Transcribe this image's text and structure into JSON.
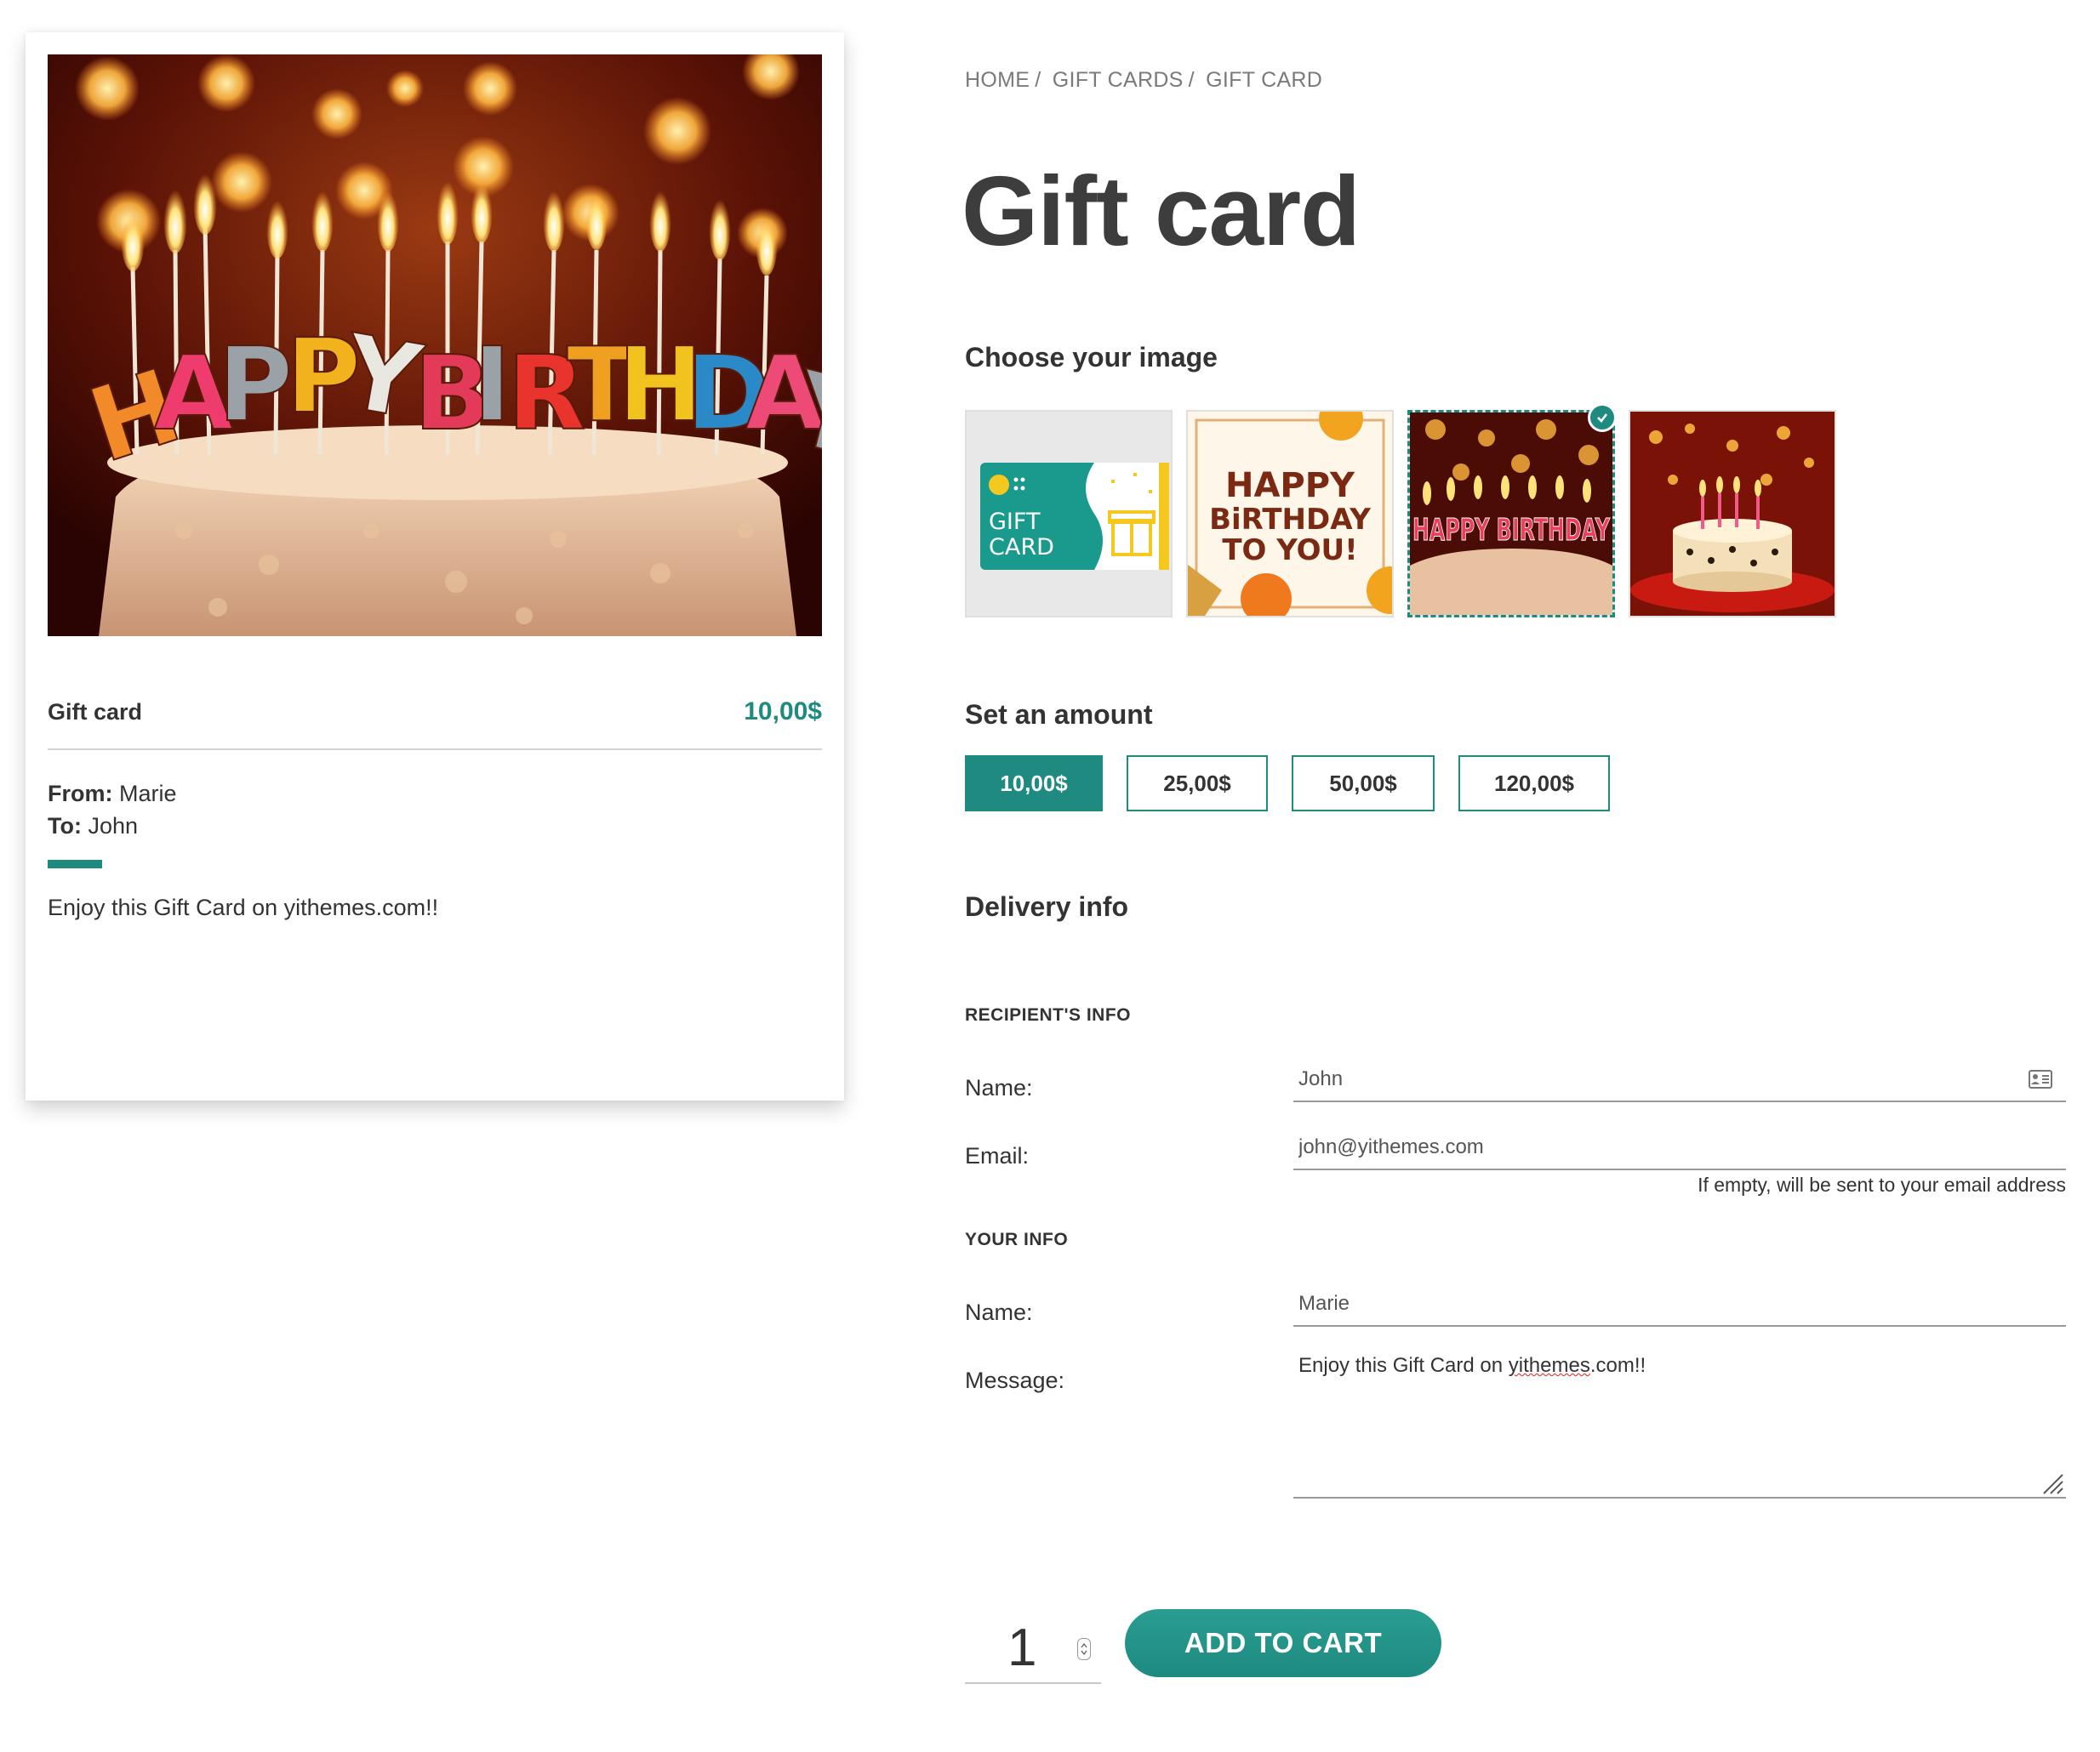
{
  "preview": {
    "title": "Gift card",
    "price": "10,00$",
    "from_label": "From:",
    "from_value": "Marie",
    "to_label": "To:",
    "to_value": "John",
    "message": "Enjoy this Gift Card on yithemes.com!!",
    "image_letters": "HAPPY BIRTHDAY"
  },
  "breadcrumb": [
    "HOME",
    "GIFT CARDS",
    "GIFT CARD"
  ],
  "breadcrumb_sep": "/",
  "page_title": "Gift card",
  "choose_image": {
    "heading": "Choose your image",
    "thumbs": [
      {
        "name": "gift-card-default",
        "line1": "GIFT",
        "line2": "CARD"
      },
      {
        "name": "happy-birthday-to-you",
        "line1": "HAPPY",
        "line2": "BiRTHDAY",
        "line3": "TO YOU!"
      },
      {
        "name": "happy-birthday-candles",
        "line1": "HAPPY BIRTHDAY",
        "selected": true
      },
      {
        "name": "birthday-cake"
      }
    ]
  },
  "amount": {
    "heading": "Set an amount",
    "options": [
      "10,00$",
      "25,00$",
      "50,00$",
      "120,00$"
    ],
    "selected": "10,00$"
  },
  "delivery": {
    "heading": "Delivery info",
    "recipient_heading": "RECIPIENT'S INFO",
    "recipient_name_label": "Name:",
    "recipient_name_value": "John",
    "recipient_email_label": "Email:",
    "recipient_email_value": "john@yithemes.com",
    "email_hint": "If empty, will be sent to your email address",
    "your_heading": "YOUR INFO",
    "your_name_label": "Name:",
    "your_name_value": "Marie",
    "message_label": "Message:",
    "message_before": "Enjoy this Gift Card on ",
    "message_spell": "yithemes",
    "message_after": ".com!!"
  },
  "cart": {
    "quantity": "1",
    "button_label": "ADD TO CART"
  },
  "colors": {
    "accent": "#1e8a80",
    "text": "#333333"
  }
}
